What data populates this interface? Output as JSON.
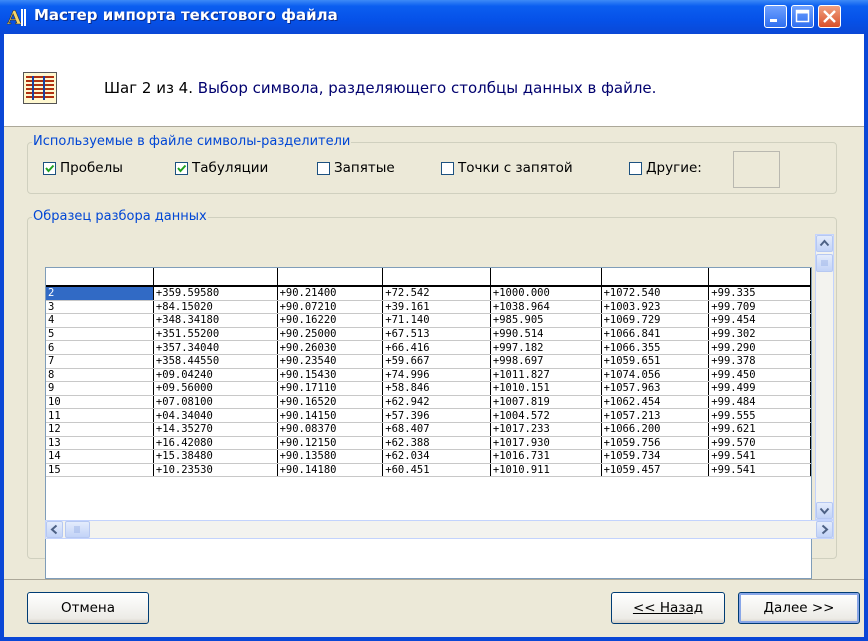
{
  "window": {
    "title": "Мастер импорта текстового файла"
  },
  "header": {
    "step": "Шаг 2 из 4.",
    "description": "Выбор символа, разделяющего столбцы данных в файле."
  },
  "delimiters": {
    "group_title": "Используемые в файле символы-разделители",
    "spaces": {
      "label": "Пробелы",
      "checked": true
    },
    "tabs": {
      "label": "Табуляции",
      "checked": true
    },
    "commas": {
      "label": "Запятые",
      "checked": false
    },
    "semicolons": {
      "label": "Точки с запятой",
      "checked": false
    },
    "other": {
      "label": "Другие:",
      "checked": false,
      "value": ""
    }
  },
  "preview": {
    "group_title": "Образец разбора данных",
    "rows": [
      [
        "2",
        "+359.59580",
        "+90.21400",
        "+72.542",
        "+1000.000",
        "+1072.540",
        "+99.335"
      ],
      [
        "3",
        "+84.15020",
        "+90.07210",
        "+39.161",
        "+1038.964",
        "+1003.923",
        "+99.709"
      ],
      [
        "4",
        "+348.34180",
        "+90.16220",
        "+71.140",
        "+985.905",
        "+1069.729",
        "+99.454"
      ],
      [
        "5",
        "+351.55200",
        "+90.25000",
        "+67.513",
        "+990.514",
        "+1066.841",
        "+99.302"
      ],
      [
        "6",
        "+357.34040",
        "+90.26030",
        "+66.416",
        "+997.182",
        "+1066.355",
        "+99.290"
      ],
      [
        "7",
        "+358.44550",
        "+90.23540",
        "+59.667",
        "+998.697",
        "+1059.651",
        "+99.378"
      ],
      [
        "8",
        "+09.04240",
        "+90.15430",
        "+74.996",
        "+1011.827",
        "+1074.056",
        "+99.450"
      ],
      [
        "9",
        "+09.56000",
        "+90.17110",
        "+58.846",
        "+1010.151",
        "+1057.963",
        "+99.499"
      ],
      [
        "10",
        "+07.08100",
        "+90.16520",
        "+62.942",
        "+1007.819",
        "+1062.454",
        "+99.484"
      ],
      [
        "11",
        "+04.34040",
        "+90.14150",
        "+57.396",
        "+1004.572",
        "+1057.213",
        "+99.555"
      ],
      [
        "12",
        "+14.35270",
        "+90.08370",
        "+68.407",
        "+1017.233",
        "+1066.200",
        "+99.621"
      ],
      [
        "13",
        "+16.42080",
        "+90.12150",
        "+62.388",
        "+1017.930",
        "+1059.756",
        "+99.570"
      ],
      [
        "14",
        "+15.38480",
        "+90.13580",
        "+62.034",
        "+1016.731",
        "+1059.734",
        "+99.541"
      ],
      [
        "15",
        "+10.23530",
        "+90.14180",
        "+60.451",
        "+1010.911",
        "+1059.457",
        "+99.541"
      ]
    ]
  },
  "buttons": {
    "cancel": "Отмена",
    "back": "<< Назад",
    "next": "Далее >>"
  },
  "colors": {
    "titlebar": "#0a52e0",
    "selection": "#316ac5",
    "group_title": "#0046d5"
  }
}
